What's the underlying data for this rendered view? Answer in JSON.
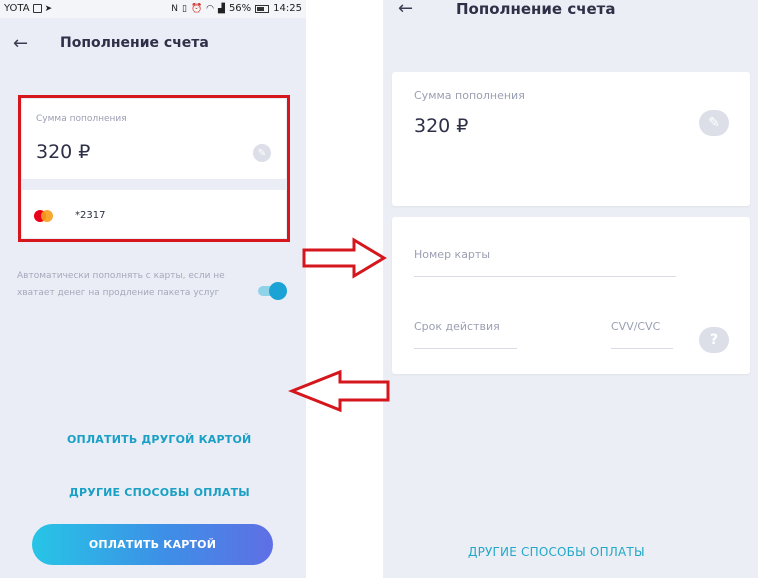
{
  "status_bar": {
    "carrier": "YOTA",
    "battery": "56%",
    "time": "14:25"
  },
  "left": {
    "title": "Пополнение счета",
    "amount_label": "Сумма пополнения",
    "amount": "320 ₽",
    "card_number": "*2317",
    "auto_text": "Автоматически пополнять с карты, если не хватает денег на продление пакета услуг",
    "auto_toggle_on": true,
    "other_card_link": "ОПЛАТИТЬ ДРУГОЙ КАРТОЙ",
    "other_methods_link": "ДРУГИЕ СПОСОБЫ ОПЛАТЫ",
    "pay_button": "ОПЛАТИТЬ КАРТОЙ"
  },
  "right": {
    "title": "Пополнение счета",
    "amount_label": "Сумма пополнения",
    "amount": "320 ₽",
    "card_number_placeholder": "Номер карты",
    "expiry_placeholder": "Срок действия",
    "cvv_placeholder": "CVV/CVC",
    "help_icon_text": "?",
    "other_methods_link": "ДРУГИЕ СПОСОБЫ ОПЛАТЫ"
  },
  "colors": {
    "accent": "#19a0c4",
    "highlight_frame": "#d5161c",
    "background": "#eaedf6"
  }
}
